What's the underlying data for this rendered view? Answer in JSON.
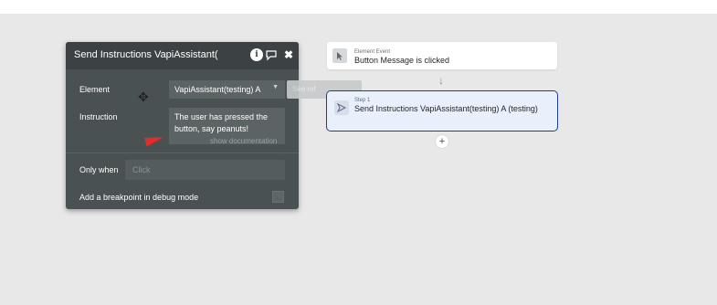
{
  "panel": {
    "title": "Send Instructions VapiAssistant(",
    "info_icon_glyph": "i",
    "comment_icon_glyph": "💬",
    "close_icon_glyph": "✖",
    "element_label": "Element",
    "element_value": "VapiAssistant(testing) A",
    "element_caret_glyph": "▼",
    "see_reference_text": "See ref",
    "instruction_label": "Instruction",
    "instruction_value": "The user has pressed the button, say peanuts!",
    "show_documentation": "show documentation",
    "only_when_label": "Only when",
    "only_when_placeholder": "Click",
    "breakpoint_label": "Add a breakpoint in debug mode"
  },
  "workflow": {
    "event": {
      "icon": "cursor-click-icon",
      "kicker": "Element Event",
      "title": "Button Message is clicked"
    },
    "arrow_glyph": "↓",
    "step": {
      "icon": "send-icon",
      "kicker": "Step 1",
      "title": "Send Instructions VapiAssistant(testing) A (testing)"
    },
    "add_glyph": "+"
  },
  "colors": {
    "panel_bg": "#4a5153",
    "panel_header": "#3c4244",
    "step_border": "#1b3f8f",
    "step_bg": "#e9f0fb",
    "annotation_arrow": "#e32d2d"
  }
}
